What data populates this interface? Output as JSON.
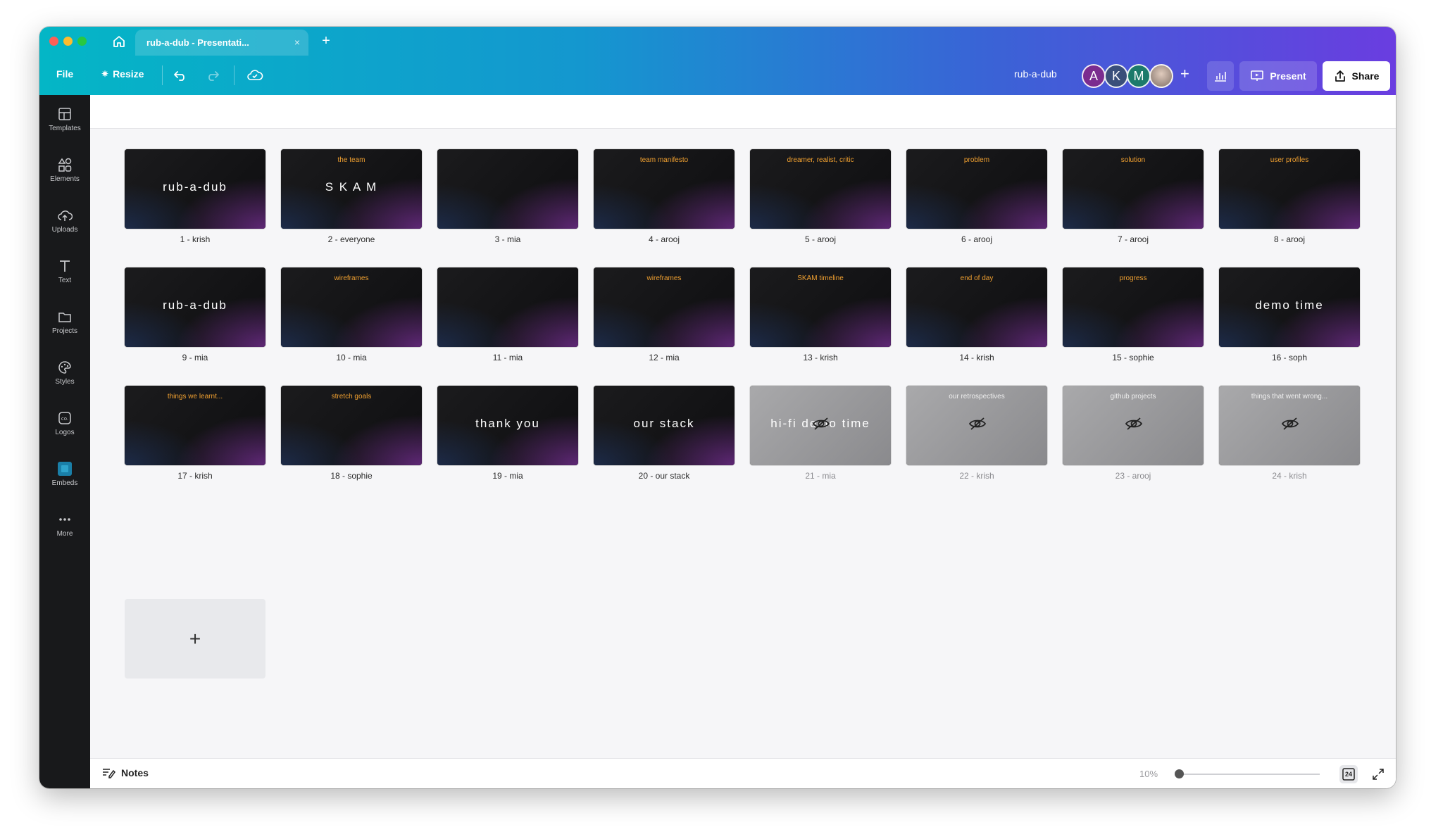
{
  "window": {
    "tab_title": "rub-a-dub - Presentati...",
    "tab_close": "×",
    "new_tab": "+"
  },
  "toolbar": {
    "file_label": "File",
    "resize_label": "Resize",
    "doc_title": "rub-a-dub",
    "present_label": "Present",
    "share_label": "Share",
    "add_collaborator": "+"
  },
  "collaborators": [
    {
      "initial": "A",
      "color": "#7b2c8f"
    },
    {
      "initial": "K",
      "color": "#3a4f7a"
    },
    {
      "initial": "M",
      "color": "#1c7a6b"
    },
    {
      "initial": "",
      "color": "#b8a8a0"
    }
  ],
  "sidebar": {
    "items": [
      {
        "label": "Templates",
        "icon": "templates-icon"
      },
      {
        "label": "Elements",
        "icon": "elements-icon"
      },
      {
        "label": "Uploads",
        "icon": "uploads-icon"
      },
      {
        "label": "Text",
        "icon": "text-icon"
      },
      {
        "label": "Projects",
        "icon": "projects-icon"
      },
      {
        "label": "Styles",
        "icon": "styles-icon"
      },
      {
        "label": "Logos",
        "icon": "logos-icon"
      },
      {
        "label": "Embeds",
        "icon": "embeds-icon"
      },
      {
        "label": "More",
        "icon": "more-icon"
      }
    ]
  },
  "slides": [
    {
      "caption": "1 - krish",
      "title": "",
      "big": "rub-a-dub",
      "hidden": false
    },
    {
      "caption": "2 - everyone",
      "title": "the team",
      "big": "S K A M",
      "hidden": false
    },
    {
      "caption": "3 - mia",
      "title": "",
      "big": "",
      "hidden": false
    },
    {
      "caption": "4 - arooj",
      "title": "team manifesto",
      "big": "",
      "hidden": false
    },
    {
      "caption": "5 - arooj",
      "title": "dreamer, realist, critic",
      "big": "",
      "hidden": false
    },
    {
      "caption": "6 - arooj",
      "title": "problem",
      "big": "",
      "hidden": false
    },
    {
      "caption": "7 - arooj",
      "title": "solution",
      "big": "",
      "hidden": false
    },
    {
      "caption": "8 - arooj",
      "title": "user profiles",
      "big": "",
      "hidden": false
    },
    {
      "caption": "9 - mia",
      "title": "",
      "big": "rub-a-dub",
      "hidden": false
    },
    {
      "caption": "10 - mia",
      "title": "wireframes",
      "big": "",
      "hidden": false
    },
    {
      "caption": "11 - mia",
      "title": "",
      "big": "",
      "hidden": false
    },
    {
      "caption": "12 - mia",
      "title": "wireframes",
      "big": "",
      "hidden": false
    },
    {
      "caption": "13 - krish",
      "title": "SKAM timeline",
      "big": "",
      "hidden": false
    },
    {
      "caption": "14 - krish",
      "title": "end of day",
      "big": "",
      "hidden": false
    },
    {
      "caption": "15 - sophie",
      "title": "progress",
      "big": "",
      "hidden": false
    },
    {
      "caption": "16 - soph",
      "title": "",
      "big": "demo time",
      "hidden": false
    },
    {
      "caption": "17 - krish",
      "title": "things we learnt...",
      "big": "",
      "hidden": false
    },
    {
      "caption": "18 - sophie",
      "title": "stretch goals",
      "big": "",
      "hidden": false
    },
    {
      "caption": "19 - mia",
      "title": "",
      "big": "thank you",
      "hidden": false
    },
    {
      "caption": "20 - our stack",
      "title": "",
      "big": "our stack",
      "hidden": false
    },
    {
      "caption": "21 - mia",
      "title": "",
      "big": "hi-fi demo time",
      "hidden": true
    },
    {
      "caption": "22 - krish",
      "title": "our retrospectives",
      "big": "",
      "hidden": true
    },
    {
      "caption": "23 - arooj",
      "title": "github projects",
      "big": "",
      "hidden": true
    },
    {
      "caption": "24 - krish",
      "title": "things that went wrong...",
      "big": "",
      "hidden": true
    }
  ],
  "add_slide_label": "+",
  "bottom": {
    "notes_label": "Notes",
    "zoom": "10%",
    "page_count": "24",
    "zoom_level": 0.0
  }
}
